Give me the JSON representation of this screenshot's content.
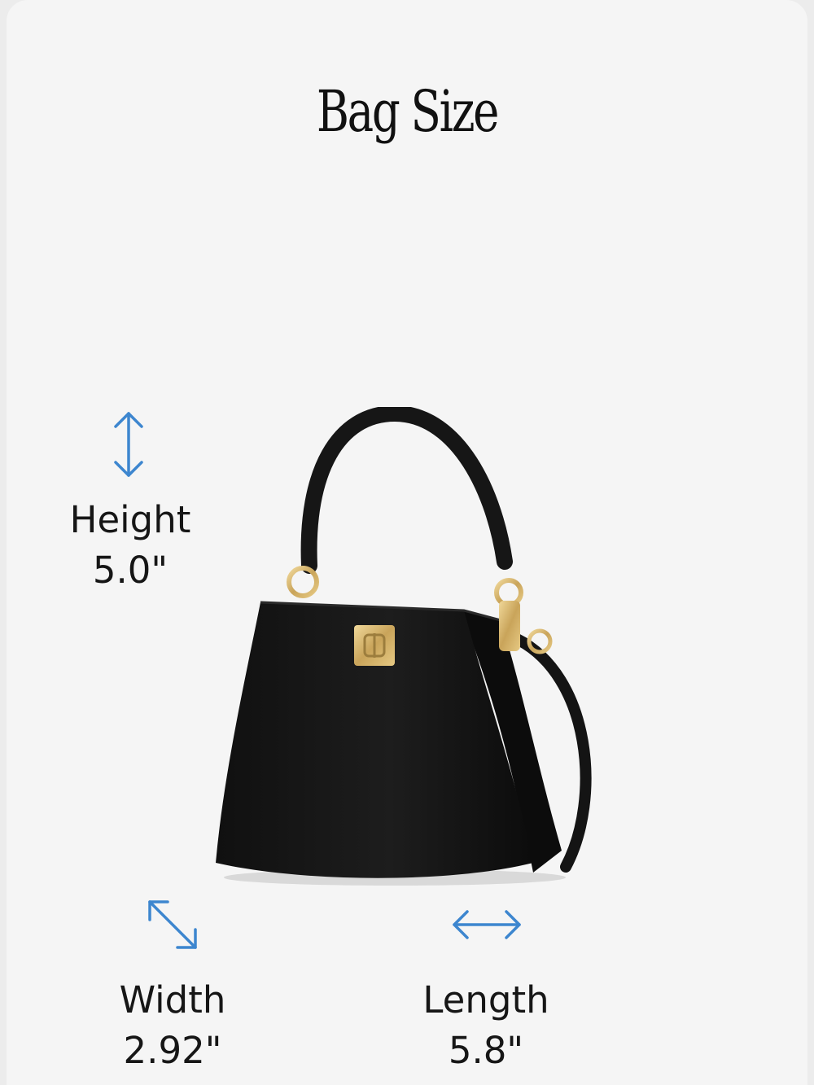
{
  "title": "Bag Size",
  "dimensions": {
    "height": {
      "label": "Height",
      "value": "5.0\"",
      "icon": "vertical-double-arrow-icon"
    },
    "width": {
      "label": "Width",
      "value": "2.92\"",
      "icon": "diagonal-double-arrow-icon"
    },
    "length": {
      "label": "Length",
      "value": "5.8\"",
      "icon": "horizontal-double-arrow-icon"
    }
  },
  "colors": {
    "arrow": "#3d86cf",
    "bag": "#151515",
    "hardware": "#d4b36a",
    "background": "#f5f5f5"
  }
}
